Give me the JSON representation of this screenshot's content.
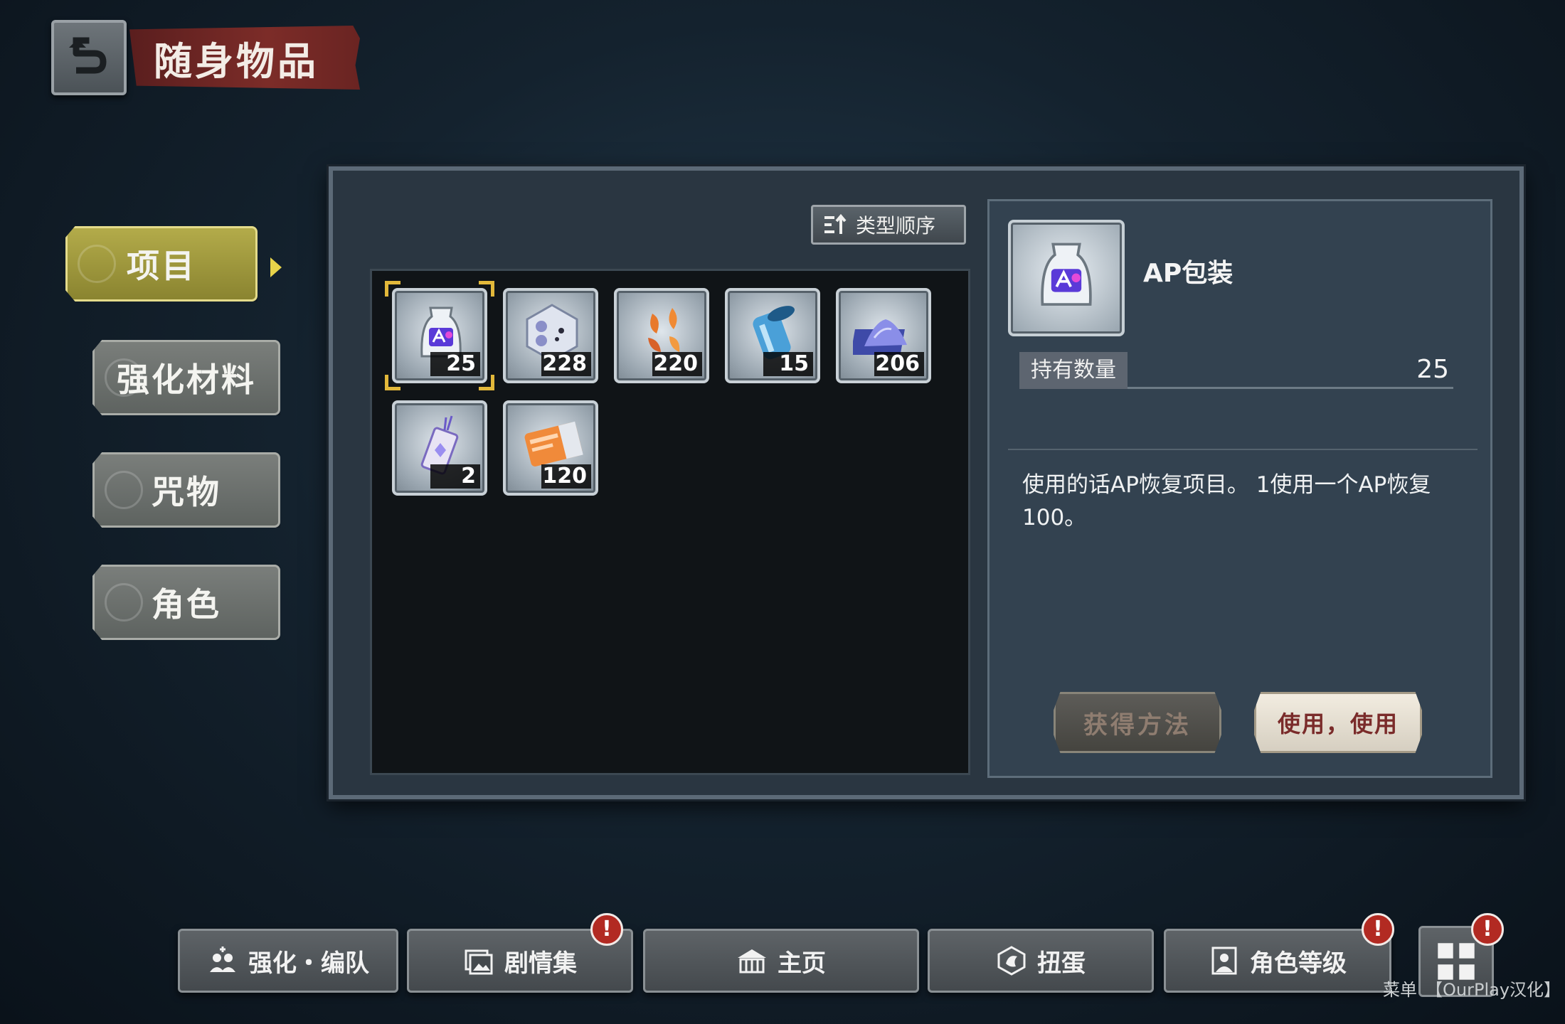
{
  "header": {
    "title": "随身物品"
  },
  "sidebar": {
    "tabs": [
      {
        "label": "项目",
        "active": true
      },
      {
        "label": "强化材料",
        "active": false
      },
      {
        "label": "咒物",
        "active": false
      },
      {
        "label": "角色",
        "active": false
      }
    ]
  },
  "inventory": {
    "sort_label": "类型顺序",
    "items": [
      {
        "icon": "ap-pack-icon",
        "count": "25",
        "selected": true
      },
      {
        "icon": "crystal-icon",
        "count": "228",
        "selected": false
      },
      {
        "icon": "leaf-icon",
        "count": "220",
        "selected": false
      },
      {
        "icon": "canister-icon",
        "count": "15",
        "selected": false
      },
      {
        "icon": "powder-icon",
        "count": "206",
        "selected": false
      },
      {
        "icon": "charm-icon",
        "count": "2",
        "selected": false
      },
      {
        "icon": "gacha-ticket-icon",
        "count": "120",
        "selected": false
      }
    ]
  },
  "detail": {
    "name": "AP包装",
    "quantity_label": "持有数量",
    "quantity_value": "25",
    "description": "使用的话AP恢复项目。 1使用一个AP恢复100。",
    "obtain_label": "获得方法",
    "use_label": "使用，使用"
  },
  "bottom_nav": {
    "items": [
      {
        "label": "强化・编队",
        "icon": "team-icon",
        "alert": false
      },
      {
        "label": "剧情集",
        "icon": "story-icon",
        "alert": true
      },
      {
        "label": "主页",
        "icon": "home-icon",
        "alert": false
      },
      {
        "label": "扭蛋",
        "icon": "gacha-icon",
        "alert": false
      },
      {
        "label": "角色等级",
        "icon": "character-icon",
        "alert": true
      }
    ],
    "menu_label": "菜单",
    "menu_alert": true,
    "alert_symbol": "!",
    "watermark": "【OurPlay汉化】"
  },
  "colors": {
    "accent_gold": "#e2b83a",
    "active_tab": "#b3ab4a",
    "alert_red": "#b22a22",
    "panel": "#2a3641"
  }
}
